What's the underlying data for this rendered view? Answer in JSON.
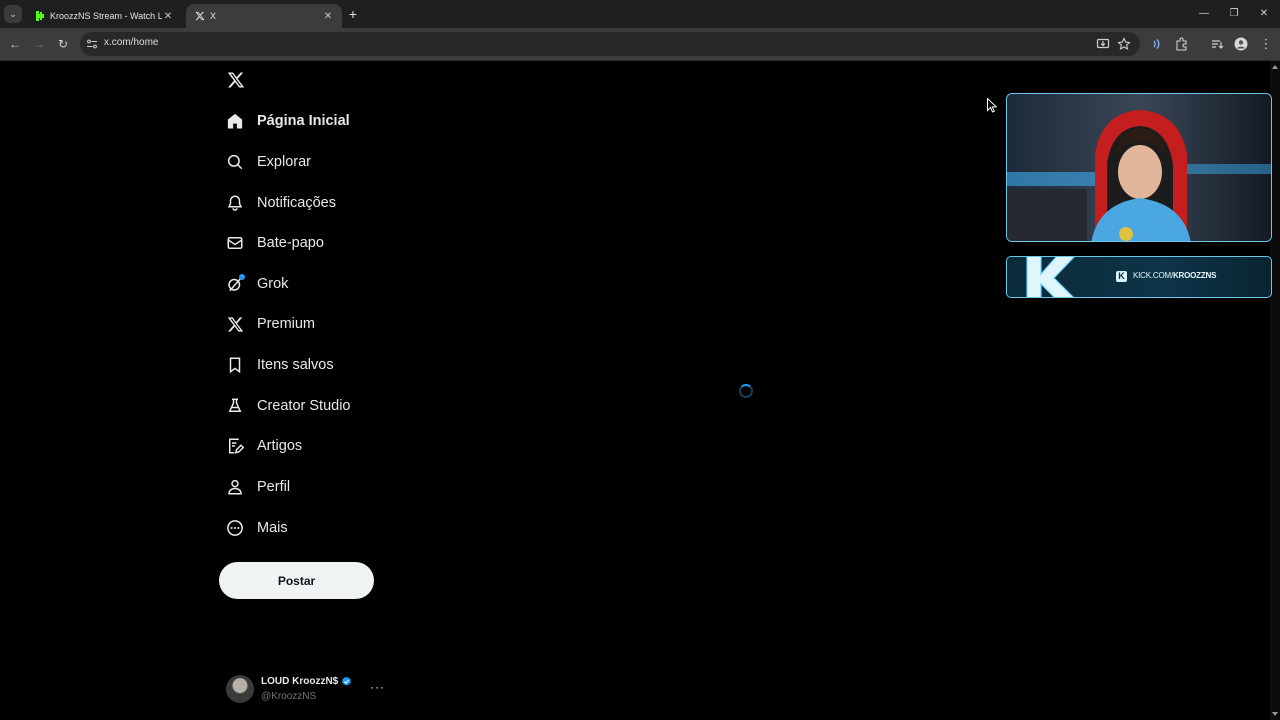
{
  "browser": {
    "tabs": [
      {
        "title": "KroozzNS Stream - Watch Live o",
        "active": false
      },
      {
        "title": "X",
        "active": true
      }
    ],
    "url": "x.com/home"
  },
  "sidebar": {
    "items": [
      {
        "label": "Página Inicial",
        "icon": "home-icon",
        "active": true
      },
      {
        "label": "Explorar",
        "icon": "search-icon"
      },
      {
        "label": "Notificações",
        "icon": "bell-icon"
      },
      {
        "label": "Bate-papo",
        "icon": "mail-icon"
      },
      {
        "label": "Grok",
        "icon": "grok-icon"
      },
      {
        "label": "Premium",
        "icon": "x-premium-icon"
      },
      {
        "label": "Itens salvos",
        "icon": "bookmark-icon"
      },
      {
        "label": "Creator Studio",
        "icon": "creator-studio-icon"
      },
      {
        "label": "Artigos",
        "icon": "articles-icon"
      },
      {
        "label": "Perfil",
        "icon": "profile-icon"
      },
      {
        "label": "Mais",
        "icon": "more-circle-icon"
      }
    ],
    "post_label": "Postar"
  },
  "account": {
    "name": "LOUD KroozzN$",
    "handle": "@KroozzNS"
  },
  "stream_overlay": {
    "banner_text_prefix": "KICK.COM/",
    "banner_text_suffix": "KROOZZNS"
  },
  "colors": {
    "accent": "#1d9bf0",
    "kick_green": "#53fc18",
    "background": "#000000"
  }
}
